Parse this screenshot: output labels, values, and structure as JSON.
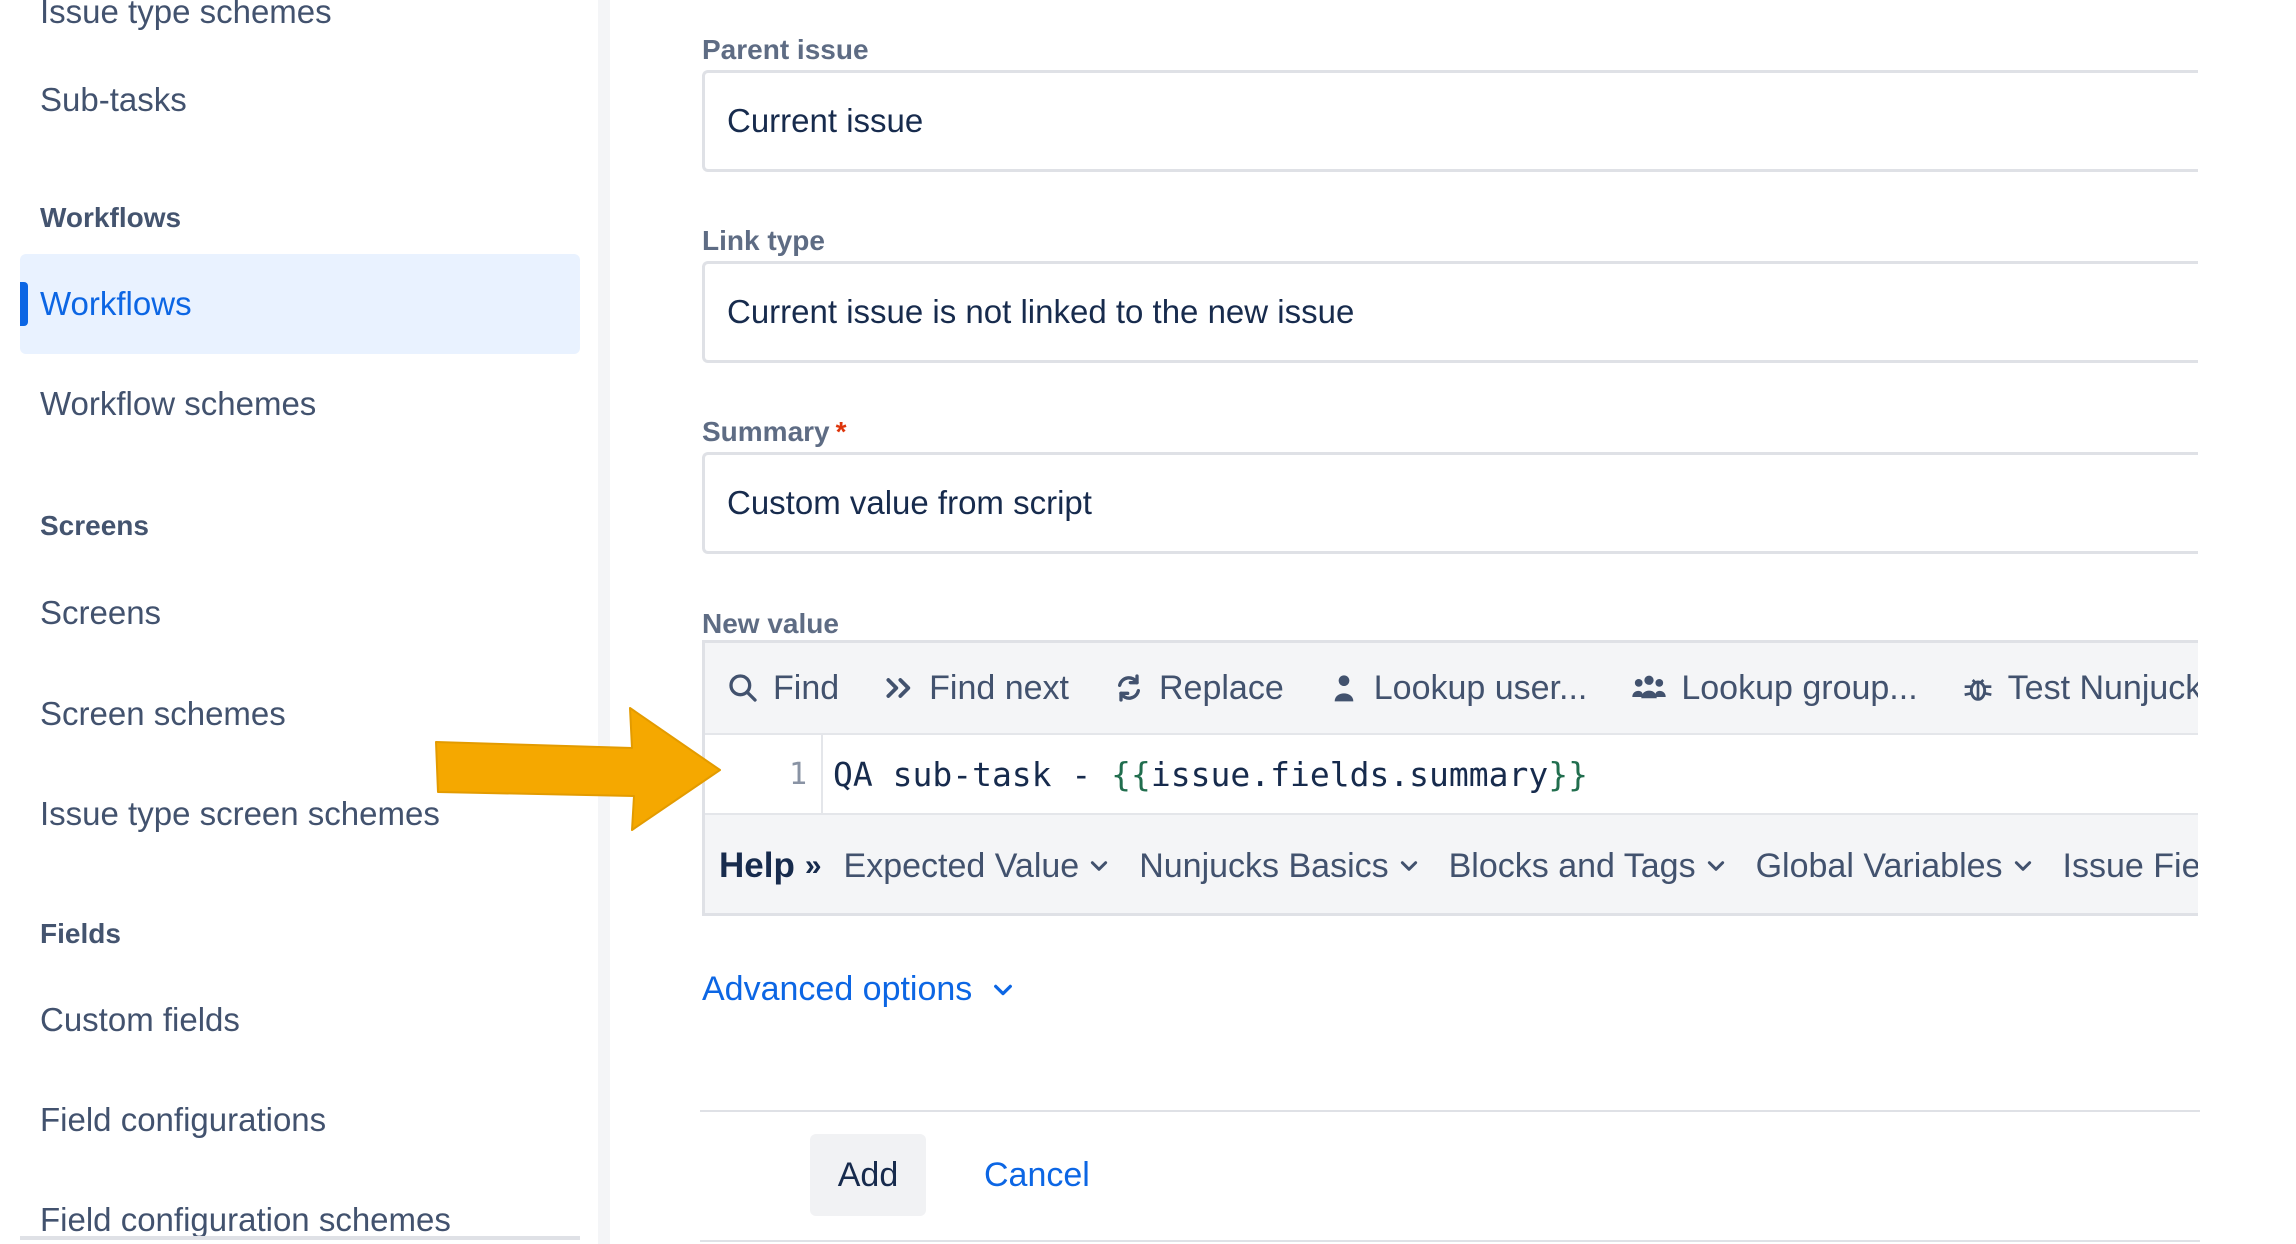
{
  "sidebar": {
    "top_partial": "Issue type schemes",
    "items": {
      "subtasks": "Sub-tasks",
      "workflows_heading": "Workflows",
      "workflows": "Workflows",
      "workflow_schemes": "Workflow schemes",
      "screens_heading": "Screens",
      "screens": "Screens",
      "screen_schemes": "Screen schemes",
      "issue_type_screen_schemes": "Issue type screen schemes",
      "fields_heading": "Fields",
      "custom_fields": "Custom fields",
      "field_configurations": "Field configurations",
      "field_configuration_schemes": "Field configuration schemes"
    },
    "active_item": "Workflows"
  },
  "form": {
    "parent_issue": {
      "label": "Parent issue",
      "value": "Current issue"
    },
    "link_type": {
      "label": "Link type",
      "value": "Current issue is not linked to the new issue"
    },
    "summary": {
      "label": "Summary",
      "required_mark": "*",
      "value": "Custom value from script"
    },
    "new_value": {
      "label": "New value",
      "toolbar": {
        "find": "Find",
        "find_next": "Find next",
        "replace": "Replace",
        "lookup_user": "Lookup user...",
        "lookup_group": "Lookup group...",
        "test_nunjucks": "Test Nunjucks"
      },
      "line_number": "1",
      "code_prefix": "QA sub-task - ",
      "code_open": "{{",
      "code_expr": "issue.fields.summary",
      "code_close": "}}",
      "help": {
        "title": "Help",
        "separator": "»",
        "items": [
          "Expected Value",
          "Nunjucks Basics",
          "Blocks and Tags",
          "Global Variables",
          "Issue Fields"
        ]
      }
    },
    "advanced_options": "Advanced options",
    "add_button": "Add",
    "cancel_link": "Cancel"
  },
  "colors": {
    "accent": "#0c66e4",
    "active_bg": "#e9f2ff",
    "arrow": "#f5a800",
    "code_brace": "#216e4e"
  }
}
